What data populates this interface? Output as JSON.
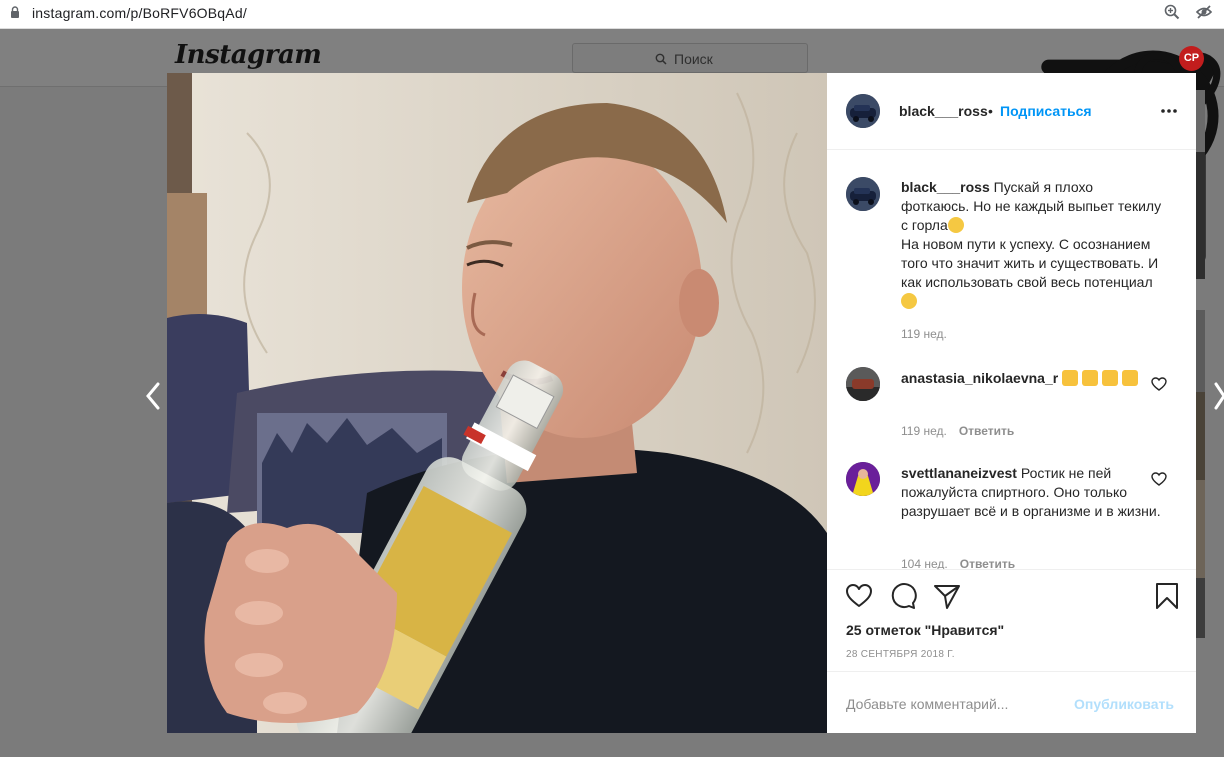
{
  "browser": {
    "url": "instagram.com/p/BoRFV6OBqAd/"
  },
  "instagram": {
    "logo": "Instagram",
    "search_placeholder": "Поиск",
    "profile_initials": "CP"
  },
  "post": {
    "author": "black___ross",
    "separator": "•",
    "follow_label": "Подписаться",
    "caption_line1": "Пускай я плохо фоткаюсь. Но не каждый выпьет текилу с горла",
    "caption_line2": "На новом пути к успеху. С осознанием того что значит жить и существовать. И как использовать свой весь потенциал",
    "caption_age": "119 нед.",
    "comments": [
      {
        "user": "anastasia_nikolaevna_r",
        "age": "119 нед.",
        "reply_label": "Ответить"
      },
      {
        "user": "svettlananeizvest",
        "text": "Ростик не пей пожалуйста спиртного. Оно только разрушает всё и в организме и в жизни.",
        "age": "104 нед.",
        "reply_label": "Ответить"
      }
    ],
    "likes": "25 отметок \"Нравится\"",
    "date": "28 СЕНТЯБРЯ 2018 Г.",
    "add_comment_placeholder": "Добавьте комментарий...",
    "publish_label": "Опубликовать"
  },
  "colors": {
    "link_blue": "#0095f6",
    "publish_disabled": "#b2dffc",
    "overlay_gray": "#7b7b7b"
  }
}
